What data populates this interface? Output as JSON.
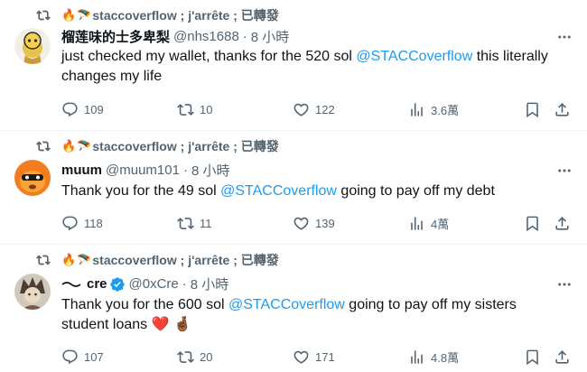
{
  "tweets": [
    {
      "repost_text": "staccoverflow ; j'arrête ; 已轉發",
      "name": "榴莲味的士多卑梨",
      "handle": "@nhs1688",
      "time": "8 小時",
      "body_pre": "just checked my wallet, thanks for the 520 sol ",
      "mention": "@STACCoverflow",
      "body_post": " this literally changes my life",
      "replies": "109",
      "reposts": "10",
      "likes": "122",
      "views": "3.6萬"
    },
    {
      "repost_text": "staccoverflow ; j'arrête ; 已轉發",
      "name": "muum",
      "handle": "@muum101",
      "time": "8 小時",
      "body_pre": "Thank you for the 49 sol ",
      "mention": "@STACCoverflow",
      "body_post": " going to pay off my debt",
      "replies": "118",
      "reposts": "11",
      "likes": "139",
      "views": "4萬"
    },
    {
      "repost_text": "staccoverflow ; j'arrête ; 已轉發",
      "name": "cre",
      "handle": "@0xCre",
      "time": "8 小時",
      "body_pre": "Thank you for the 600 sol ",
      "mention": "@STACCoverflow",
      "body_post": " going to pay off my sisters student loans ❤️ 🤞🏾",
      "replies": "107",
      "reposts": "20",
      "likes": "171",
      "views": "4.8萬"
    }
  ],
  "colors": {
    "accent": "#1d9bf0",
    "secondary_text": "#536471",
    "primary_text": "#0f1419"
  }
}
